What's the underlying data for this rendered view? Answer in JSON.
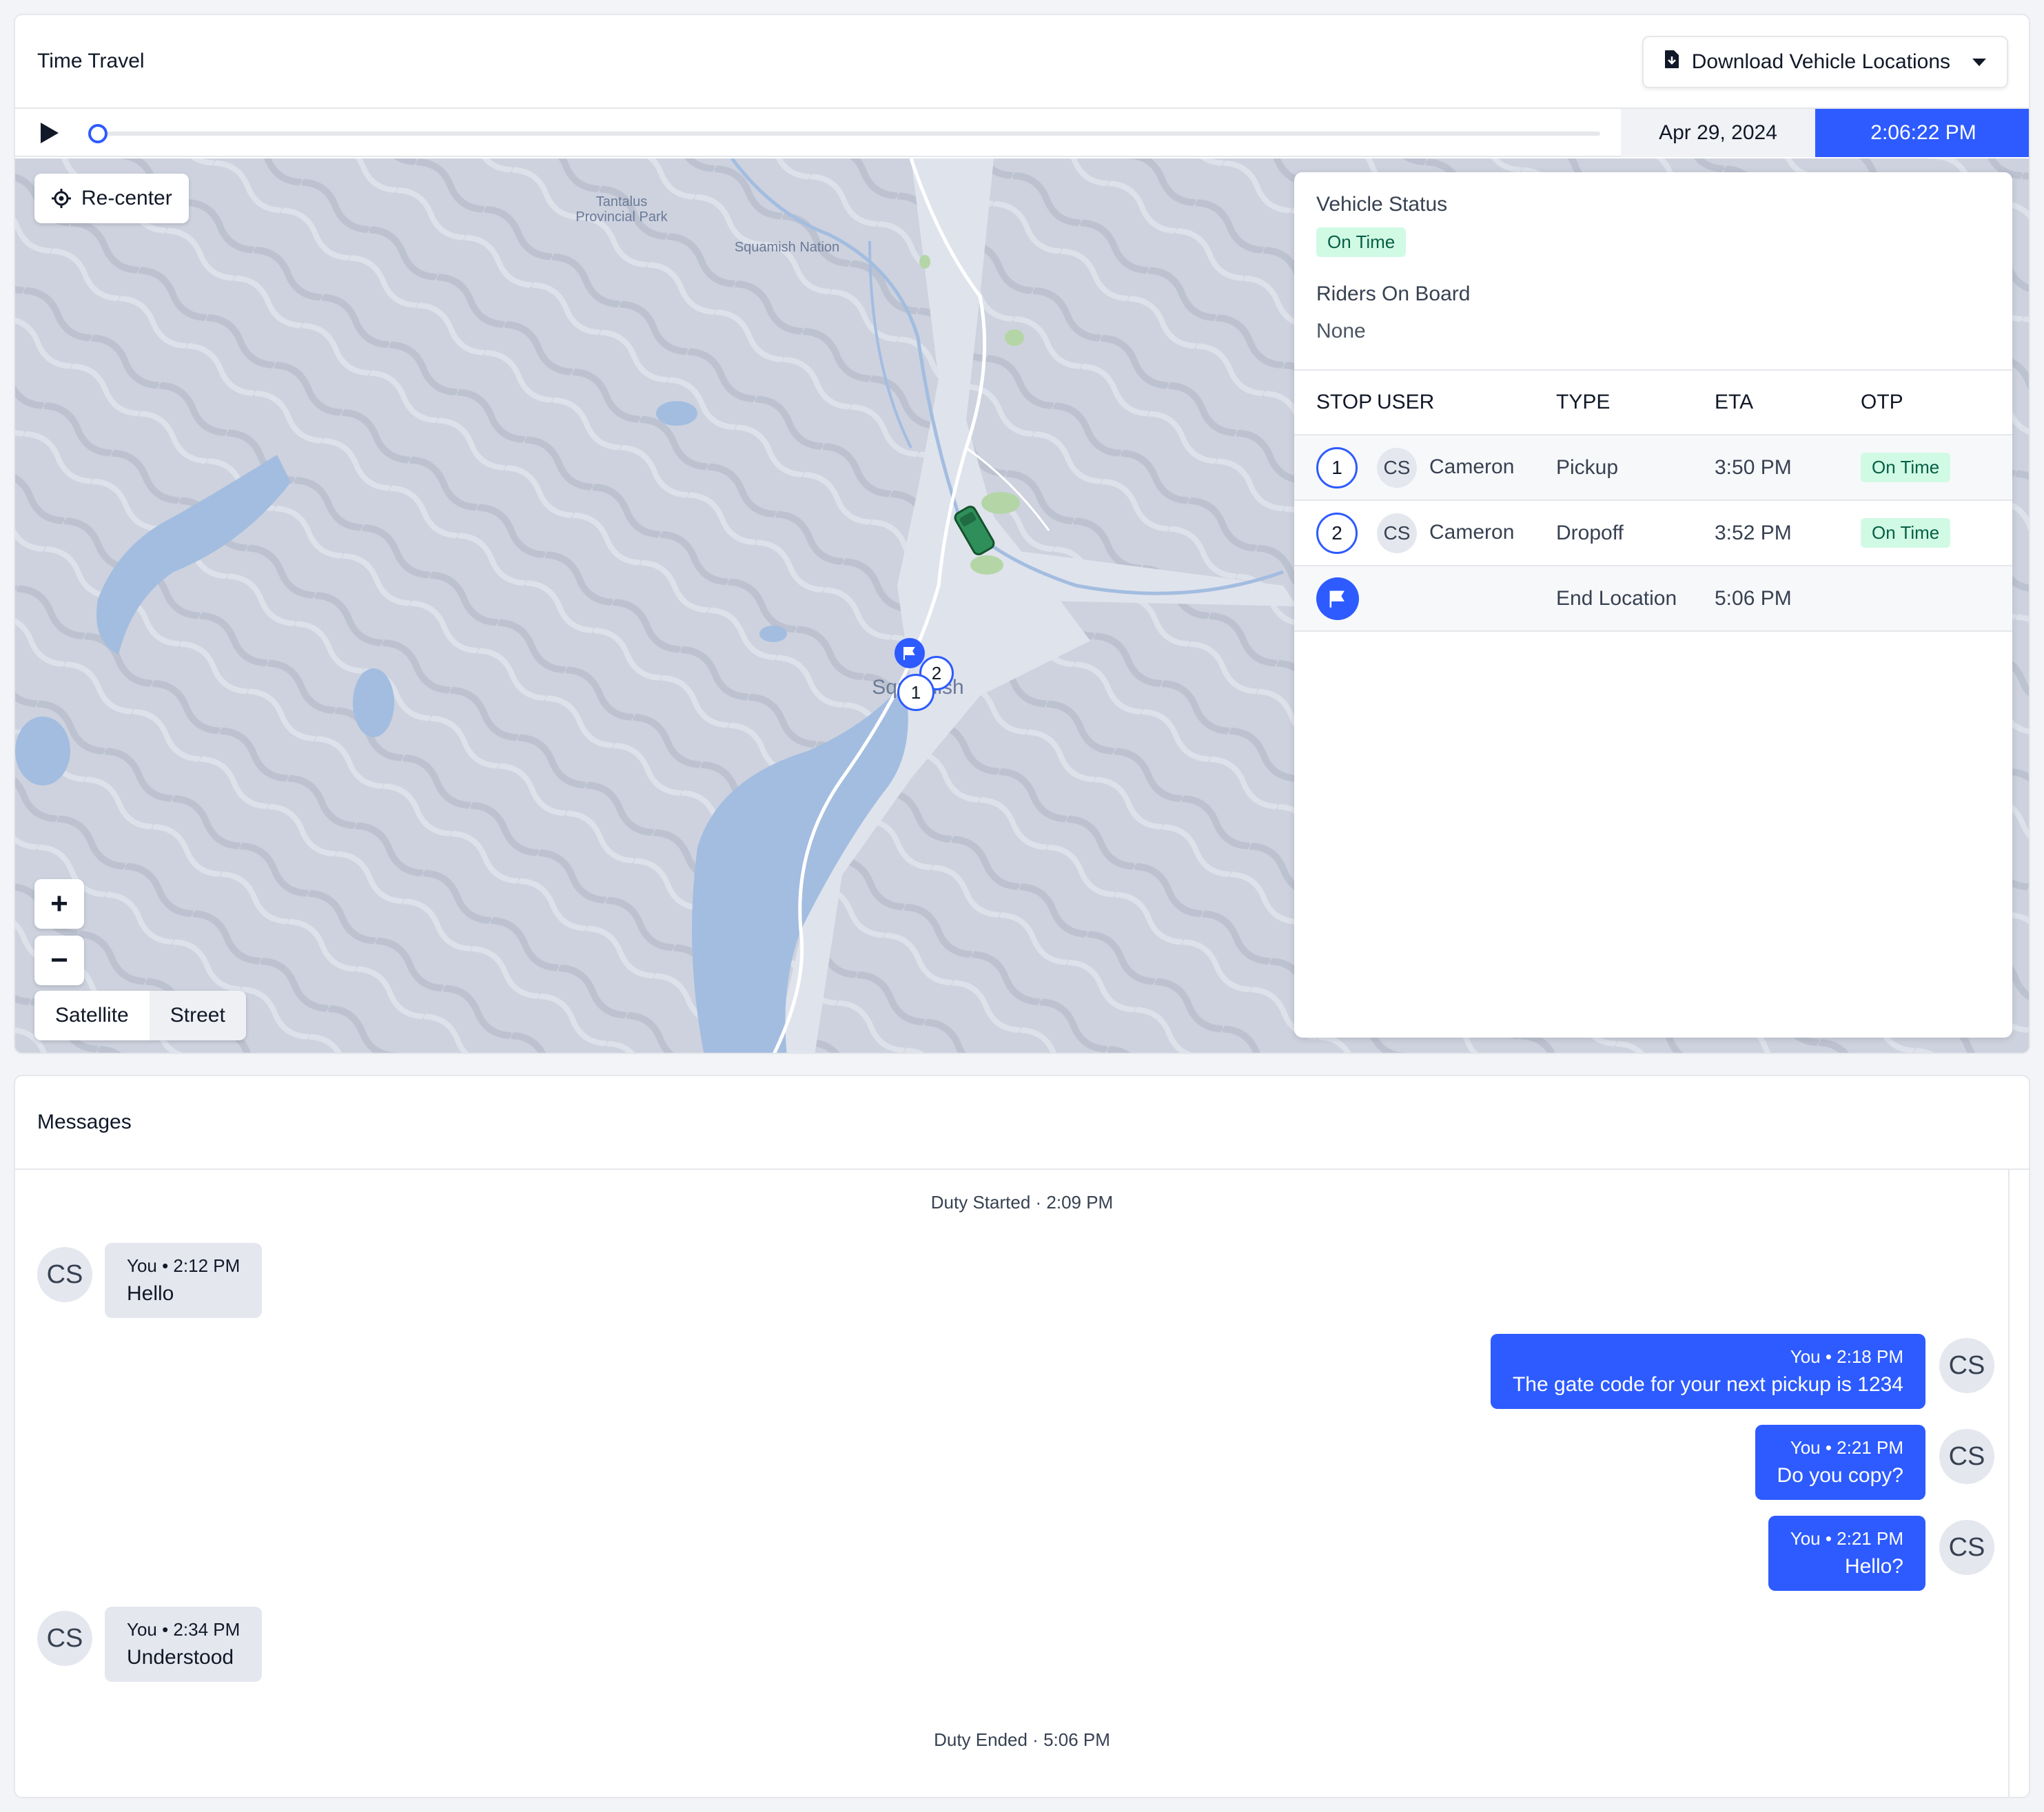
{
  "time_travel": {
    "title": "Time Travel",
    "download_label": "Download Vehicle Locations",
    "date": "Apr 29, 2024",
    "time": "2:06:22 PM",
    "playback_progress": 0
  },
  "map": {
    "recenter_label": "Re-center",
    "zoom_in": "+",
    "zoom_out": "−",
    "type_satellite": "Satellite",
    "type_street": "Street",
    "labels": {
      "park": "Tantalus\nProvincial Park",
      "nation": "Squamish Nation",
      "town": "Squamish"
    },
    "markers": {
      "stop1": "1",
      "stop2": "2"
    }
  },
  "panel": {
    "vehicle_status_label": "Vehicle Status",
    "vehicle_status": "On Time",
    "riders_label": "Riders On Board",
    "riders_value": "None",
    "columns": [
      "STOP",
      "USER",
      "TYPE",
      "ETA",
      "OTP"
    ],
    "rows": [
      {
        "stop": "1",
        "initials": "CS",
        "user": "Cameron",
        "type": "Pickup",
        "eta": "3:50 PM",
        "otp": "On Time"
      },
      {
        "stop": "2",
        "initials": "CS",
        "user": "Cameron",
        "type": "Dropoff",
        "eta": "3:52 PM",
        "otp": "On Time"
      },
      {
        "stop": "",
        "initials": "",
        "user": "",
        "type": "End Location",
        "eta": "5:06 PM",
        "otp": ""
      }
    ]
  },
  "messages": {
    "title": "Messages",
    "duty_started": "Duty Started · 2:09 PM",
    "duty_ended": "Duty Ended · 5:06 PM",
    "items": [
      {
        "initials": "CS",
        "meta": "You • 2:12 PM",
        "text": "Hello"
      },
      {
        "initials": "CS",
        "meta": "You • 2:18 PM",
        "text": "The gate code for your next pickup is 1234"
      },
      {
        "initials": "CS",
        "meta": "You • 2:21 PM",
        "text": "Do you copy?"
      },
      {
        "initials": "CS",
        "meta": "You • 2:21 PM",
        "text": "Hello?"
      },
      {
        "initials": "CS",
        "meta": "You • 2:34 PM",
        "text": "Understood"
      }
    ]
  },
  "colors": {
    "accent": "#2d5bff",
    "on_time_bg": "#d1fae5",
    "on_time_text": "#065f46",
    "vehicle": "#2f8f5b"
  }
}
